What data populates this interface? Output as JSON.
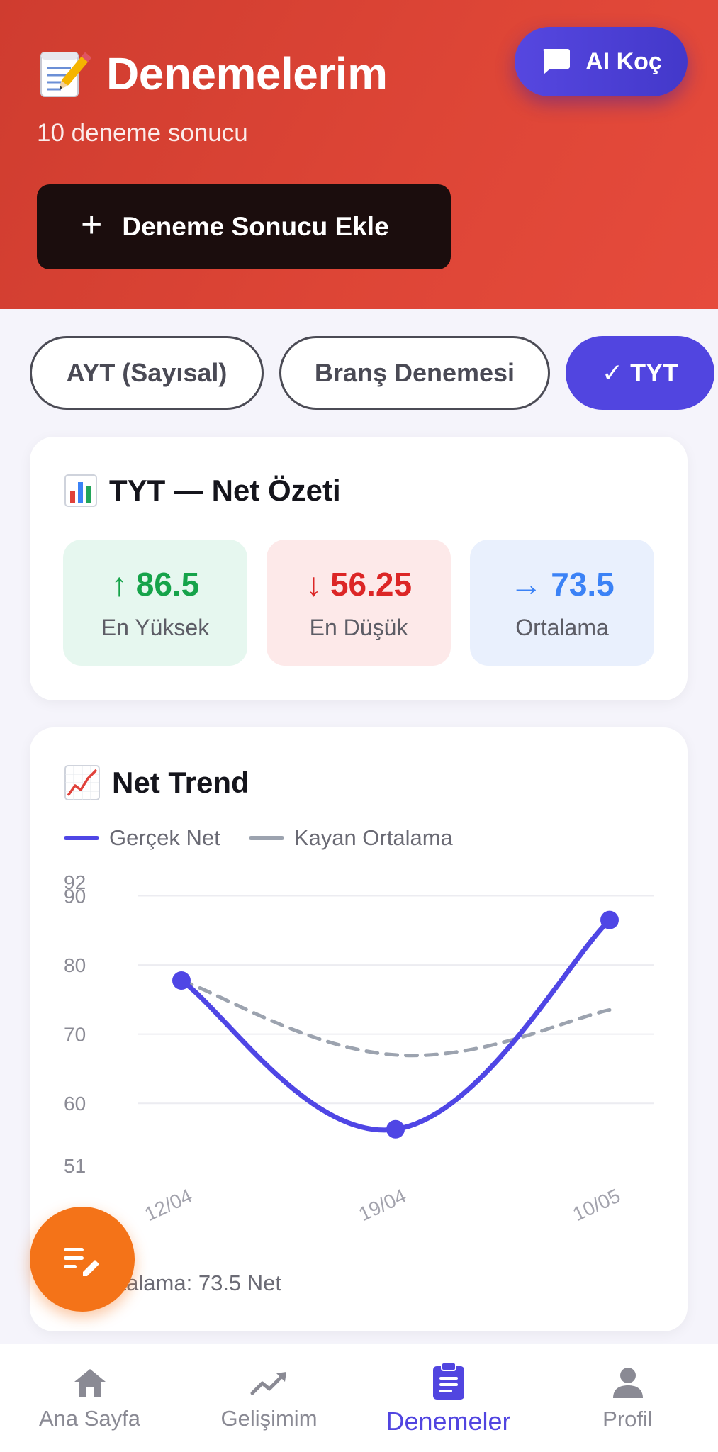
{
  "header": {
    "title": "Denemelerim",
    "subtitle": "10 deneme sonucu",
    "ai_button_label": "AI Koç",
    "add_button_label": "Deneme Sonucu Ekle"
  },
  "filters": [
    {
      "label": "AYT (Sayısal)",
      "active": false
    },
    {
      "label": "Branş Denemesi",
      "active": false
    },
    {
      "label": "✓ TYT",
      "active": true
    }
  ],
  "summary": {
    "title": "TYT — Net Özeti",
    "stats": [
      {
        "value": "86.5",
        "label": "En Yüksek",
        "arrow": "↑",
        "color": "#16a34a",
        "bg": "#e6f7ef"
      },
      {
        "value": "56.25",
        "label": "En Düşük",
        "arrow": "↓",
        "color": "#dc2626",
        "bg": "#fde9e9"
      },
      {
        "value": "73.5",
        "label": "Ortalama",
        "arrow": "→",
        "color": "#3b82f6",
        "bg": "#e9f0fd"
      }
    ]
  },
  "trend": {
    "title": "Net Trend",
    "legend": [
      "Gerçek Net",
      "Kayan Ortalama"
    ],
    "footer": "ortalama: 73.5 Net"
  },
  "chart_data": {
    "type": "line",
    "categories": [
      "12/04",
      "19/04",
      "10/05"
    ],
    "series": [
      {
        "name": "Gerçek Net",
        "values": [
          77.75,
          56.25,
          86.5
        ],
        "color": "#4f46e5"
      },
      {
        "name": "Kayan Ortalama",
        "values": [
          77.75,
          67,
          73.5
        ],
        "color": "#9ca3af"
      }
    ],
    "y_ticks": [
      51,
      60,
      70,
      80,
      90,
      92
    ],
    "ylim": [
      51,
      92
    ],
    "grid": true
  },
  "nav": [
    {
      "label": "Ana Sayfa",
      "icon": "home-icon",
      "active": false
    },
    {
      "label": "Gelişimim",
      "icon": "trending-up-icon",
      "active": false
    },
    {
      "label": "Denemeler",
      "icon": "clipboard-icon",
      "active": true
    },
    {
      "label": "Profil",
      "icon": "person-icon",
      "active": false
    }
  ],
  "colors": {
    "header_red": "#d9412f",
    "accent_purple": "#5145e0",
    "fab_orange": "#f47318"
  }
}
